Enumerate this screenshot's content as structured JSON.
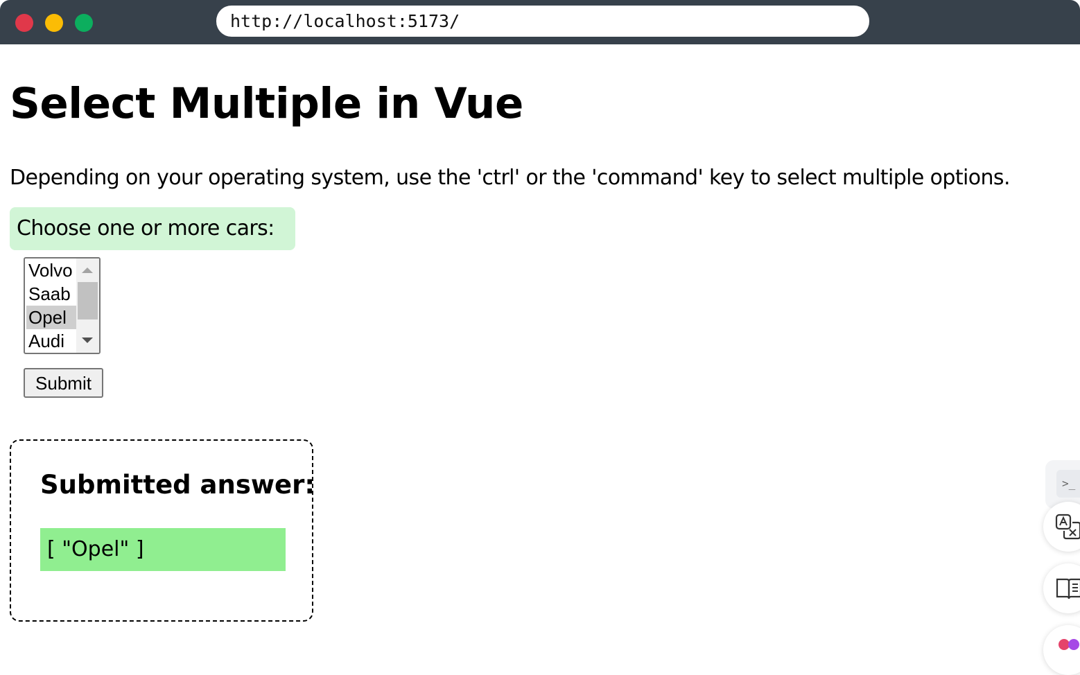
{
  "browser": {
    "url": "http://localhost:5173/",
    "traffic_lights": {
      "close": "#e0384a",
      "minimize": "#fbbc05",
      "maximize": "#0cae5e"
    }
  },
  "page": {
    "title": "Select Multiple in Vue",
    "intro": "Depending on your operating system, use the 'ctrl' or the 'command' key to select multiple options.",
    "select_label": "Choose one or more cars:",
    "options": [
      {
        "label": "Volvo",
        "selected": false
      },
      {
        "label": "Saab",
        "selected": false
      },
      {
        "label": "Opel",
        "selected": true
      },
      {
        "label": "Audi",
        "selected": false
      }
    ],
    "submit_label": "Submit",
    "answer_heading": "Submitted answer:",
    "answer_value": "[ \"Opel\" ]"
  },
  "side_tools": [
    {
      "icon": "terminal-icon"
    },
    {
      "icon": "translate-icon"
    },
    {
      "icon": "reader-icon"
    },
    {
      "icon": "colorful-app-icon"
    }
  ],
  "colors": {
    "label_background": "#d1f5d6",
    "answer_background": "#90ee90",
    "selected_option": "#cecece"
  }
}
